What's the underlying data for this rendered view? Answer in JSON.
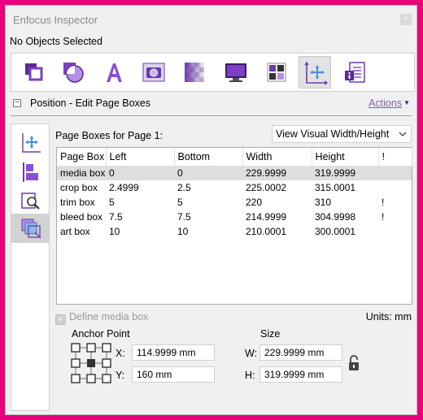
{
  "window": {
    "title": "Enfocus Inspector",
    "close_glyph": "×"
  },
  "selection_status": "No Objects Selected",
  "toolbar": {
    "tools": [
      {
        "icon": "object-layers-icon"
      },
      {
        "icon": "shape-icon"
      },
      {
        "icon": "text-icon"
      },
      {
        "icon": "image-icon"
      },
      {
        "icon": "transparency-icon"
      },
      {
        "icon": "monitor-icon"
      },
      {
        "icon": "layout-grid-icon"
      },
      {
        "icon": "position-icon",
        "active": true
      },
      {
        "icon": "document-info-icon"
      }
    ]
  },
  "section": {
    "toggle": "−",
    "title": "Position - Edit Page Boxes",
    "actions_label": "Actions"
  },
  "sidetabs": [
    {
      "icon": "move-icon"
    },
    {
      "icon": "align-icon"
    },
    {
      "icon": "crop-zoom-icon"
    },
    {
      "icon": "page-boxes-icon",
      "active": true
    }
  ],
  "page_boxes": {
    "label": "Page Boxes for Page 1:",
    "view_select": "View Visual Width/Height",
    "columns": [
      "Page Box",
      "Left",
      "Bottom",
      "Width",
      "Height",
      "!"
    ],
    "rows": [
      {
        "name": "media box",
        "left": "0",
        "bottom": "0",
        "width": "229.9999",
        "height": "319.9999",
        "warn": "",
        "selected": true
      },
      {
        "name": "crop box",
        "left": "2.4999",
        "bottom": "2.5",
        "width": "225.0002",
        "height": "315.0001",
        "warn": ""
      },
      {
        "name": "trim box",
        "left": "5",
        "bottom": "5",
        "width": "220",
        "height": "310",
        "warn": "!"
      },
      {
        "name": "bleed box",
        "left": "7.5",
        "bottom": "7.5",
        "width": "214.9999",
        "height": "304.9998",
        "warn": "!"
      },
      {
        "name": "art box",
        "left": "10",
        "bottom": "10",
        "width": "210.0001",
        "height": "300.0001",
        "warn": ""
      }
    ]
  },
  "define_media_box": {
    "label": "Define media box",
    "checked": true,
    "enabled": false
  },
  "units": "Units: mm",
  "anchor": {
    "label": "Anchor Point",
    "x_label": "X:",
    "x_value": "114.9999 mm",
    "y_label": "Y:",
    "y_value": "160 mm"
  },
  "size": {
    "label": "Size",
    "w_label": "W:",
    "w_value": "229.9999 mm",
    "h_label": "H:",
    "h_value": "319.9999 mm"
  },
  "colors": {
    "accent": "#8a4fd6",
    "frame": "#e8017a",
    "selected_row": "#dedede"
  }
}
